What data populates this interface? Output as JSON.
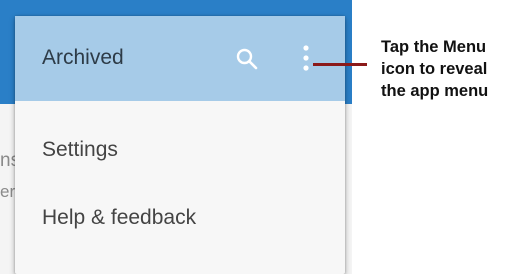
{
  "background": {
    "text1": "nston",
    "text2": "er."
  },
  "menu": {
    "header_title": "Archived",
    "items": [
      {
        "label": "Settings"
      },
      {
        "label": "Help & feedback"
      }
    ]
  },
  "icons": {
    "search": "search-icon",
    "more": "more-vert-icon"
  },
  "callout": {
    "lines": [
      "Tap the Menu",
      "icon to reveal",
      "the app menu"
    ]
  },
  "colors": {
    "app_bar": "#2a7fc7",
    "menu_header": "#a6cbe8",
    "callout_line": "#8b1a1a"
  }
}
